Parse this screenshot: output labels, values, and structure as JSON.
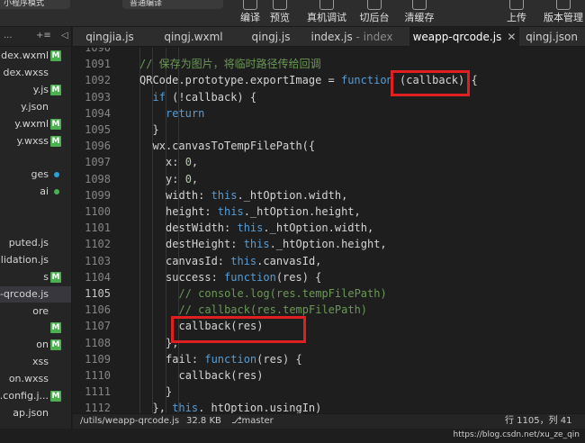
{
  "toolbar": {
    "mode_label": "小程序模式",
    "compile_label": "普通编译",
    "buttons": {
      "compile": "编译",
      "preview": "预览",
      "remote_debug": "真机调试",
      "background": "切后台",
      "clear_cache": "清缓存",
      "upload": "上传",
      "version_mgmt": "版本管理"
    }
  },
  "sidebar": {
    "head": {
      "more": "...",
      "sort": "+≡",
      "arrow": "◁"
    },
    "files": [
      {
        "name": "dex.wxml",
        "badge": "M",
        "active": false
      },
      {
        "name": "dex.wxss",
        "badge": "",
        "active": false
      },
      {
        "name": "y.js",
        "badge": "M",
        "active": false
      },
      {
        "name": "y.json",
        "badge": "",
        "active": false
      },
      {
        "name": "y.wxml",
        "badge": "M",
        "active": false
      },
      {
        "name": "y.wxss",
        "badge": "M",
        "active": false
      },
      {
        "name": "",
        "badge": "",
        "active": false
      },
      {
        "name": "ges",
        "badge": "",
        "dot": "#2aa1d6",
        "active": false
      },
      {
        "name": "ai",
        "badge": "",
        "dot": "#4caf50",
        "active": false
      },
      {
        "name": "",
        "badge": "",
        "active": false
      },
      {
        "name": "",
        "badge": "",
        "active": false
      },
      {
        "name": "puted.js",
        "badge": "",
        "active": false
      },
      {
        "name": "Validation.js",
        "badge": "",
        "active": false
      },
      {
        "name": "s",
        "badge": "M",
        "active": false
      },
      {
        "name": "pp-qrcode.js",
        "badge": "",
        "active": true
      },
      {
        "name": "ore",
        "badge": "",
        "active": false
      },
      {
        "name": "",
        "badge": "M",
        "active": false
      },
      {
        "name": "on",
        "badge": "M",
        "active": false
      },
      {
        "name": "xss",
        "badge": "",
        "active": false
      },
      {
        "name": "on.wxss",
        "badge": "",
        "active": false
      },
      {
        "name": "t.config.j...",
        "badge": "M",
        "active": false
      },
      {
        "name": "ap.json",
        "badge": "",
        "active": false
      }
    ]
  },
  "tabs": [
    {
      "label": "qingjia.js",
      "muted": "",
      "active": false
    },
    {
      "label": "qingj.wxml",
      "muted": "",
      "active": false
    },
    {
      "label": "qingj.js",
      "muted": "",
      "active": false
    },
    {
      "label": "index.js",
      "muted": " - index",
      "active": false
    },
    {
      "label": "weapp-qrcode.js",
      "muted": "",
      "active": true,
      "close": "✕"
    },
    {
      "label": "qingj.json",
      "muted": "",
      "active": false
    }
  ],
  "editor": {
    "current_line": "1105",
    "lines": [
      {
        "no": "1090",
        "indent": 0,
        "tokens": []
      },
      {
        "no": "1091",
        "indent": 1,
        "tokens": [
          [
            "c",
            "// 保存为图片，将临时路径传给回调"
          ]
        ]
      },
      {
        "no": "1092",
        "indent": 1,
        "tokens": [
          [
            "p",
            "QRCode.prototype.exportImage = "
          ],
          [
            "k",
            "function"
          ],
          [
            "p",
            " (callback) {"
          ]
        ]
      },
      {
        "no": "1093",
        "indent": 2,
        "tokens": [
          [
            "k",
            "if"
          ],
          [
            "p",
            " (!callback) {"
          ]
        ]
      },
      {
        "no": "1094",
        "indent": 3,
        "tokens": [
          [
            "k",
            "return"
          ]
        ]
      },
      {
        "no": "1095",
        "indent": 2,
        "tokens": [
          [
            "p",
            "}"
          ]
        ]
      },
      {
        "no": "1096",
        "indent": 2,
        "tokens": [
          [
            "p",
            "wx.canvasToTempFilePath({"
          ]
        ]
      },
      {
        "no": "1097",
        "indent": 3,
        "tokens": [
          [
            "p",
            "x: "
          ],
          [
            "n",
            "0"
          ],
          [
            "p",
            ","
          ]
        ]
      },
      {
        "no": "1098",
        "indent": 3,
        "tokens": [
          [
            "p",
            "y: "
          ],
          [
            "n",
            "0"
          ],
          [
            "p",
            ","
          ]
        ]
      },
      {
        "no": "1099",
        "indent": 3,
        "tokens": [
          [
            "p",
            "width: "
          ],
          [
            "k",
            "this"
          ],
          [
            "p",
            "._htOption.width,"
          ]
        ]
      },
      {
        "no": "1100",
        "indent": 3,
        "tokens": [
          [
            "p",
            "height: "
          ],
          [
            "k",
            "this"
          ],
          [
            "p",
            "._htOption.height,"
          ]
        ]
      },
      {
        "no": "1101",
        "indent": 3,
        "tokens": [
          [
            "p",
            "destWidth: "
          ],
          [
            "k",
            "this"
          ],
          [
            "p",
            "._htOption.width,"
          ]
        ]
      },
      {
        "no": "1102",
        "indent": 3,
        "tokens": [
          [
            "p",
            "destHeight: "
          ],
          [
            "k",
            "this"
          ],
          [
            "p",
            "._htOption.height,"
          ]
        ]
      },
      {
        "no": "1103",
        "indent": 3,
        "tokens": [
          [
            "p",
            "canvasId: "
          ],
          [
            "k",
            "this"
          ],
          [
            "p",
            ".canvasId,"
          ]
        ]
      },
      {
        "no": "1104",
        "indent": 3,
        "tokens": [
          [
            "p",
            "success: "
          ],
          [
            "k",
            "function"
          ],
          [
            "p",
            "(res) {"
          ]
        ]
      },
      {
        "no": "1105",
        "indent": 4,
        "tokens": [
          [
            "c",
            "// console.log(res.tempFilePath)"
          ]
        ]
      },
      {
        "no": "1106",
        "indent": 4,
        "tokens": [
          [
            "c",
            "// callback(res.tempFilePath)"
          ]
        ]
      },
      {
        "no": "1107",
        "indent": 4,
        "tokens": [
          [
            "p",
            "callback(res)"
          ]
        ]
      },
      {
        "no": "1108",
        "indent": 3,
        "tokens": [
          [
            "p",
            "},"
          ]
        ]
      },
      {
        "no": "1109",
        "indent": 3,
        "tokens": [
          [
            "p",
            "fail: "
          ],
          [
            "k",
            "function"
          ],
          [
            "p",
            "(res) {"
          ]
        ]
      },
      {
        "no": "1110",
        "indent": 4,
        "tokens": [
          [
            "p",
            "callback(res)"
          ]
        ]
      },
      {
        "no": "1111",
        "indent": 3,
        "tokens": [
          [
            "p",
            "}"
          ]
        ]
      },
      {
        "no": "1112",
        "indent": 2,
        "tokens": [
          [
            "p",
            "}, "
          ],
          [
            "k",
            "this"
          ],
          [
            "p",
            "._htOption.usingIn)"
          ]
        ]
      }
    ]
  },
  "status": {
    "path": "/utils/weapp-qrcode.js",
    "size": "32.8 KB",
    "branch": "master",
    "cursor": "行 1105，列 41"
  },
  "watermark": "https://blog.csdn.net/xu_ze_qin",
  "colors": {
    "highlight_box": "#e02020",
    "badge": "#4caf50",
    "keyword": "#569cd6",
    "comment": "#6a9955",
    "number": "#b5cea8"
  }
}
